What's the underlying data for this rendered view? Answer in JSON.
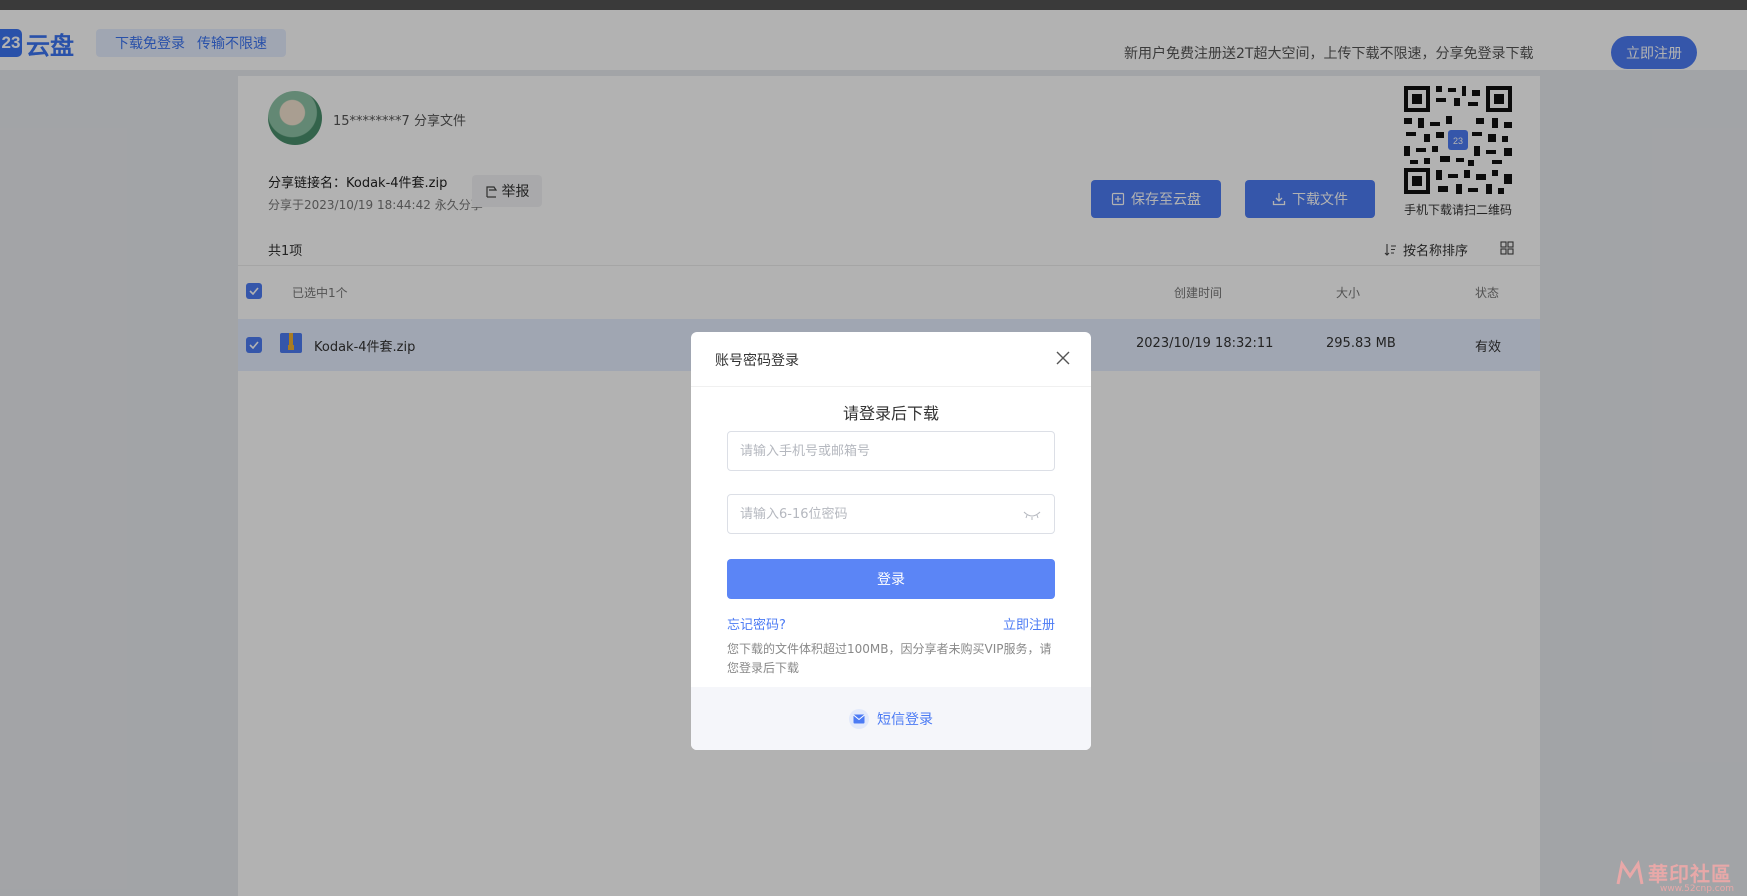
{
  "header": {
    "logo_mark": "23",
    "logo_text": "云盘",
    "promo_1": "下载免登录",
    "promo_2": "传输不限速",
    "note": "新用户免费注册送2T超大空间，上传下载不限速，分享免登录下载",
    "register_label": "立即注册"
  },
  "share": {
    "sharer": "15********7 分享文件",
    "link_name": "分享链接名：Kodak-4件套.zip",
    "date": "分享于2023/10/19 18:44:42 永久分享",
    "report_label": "举报",
    "save_label": "保存至云盘",
    "download_label": "下载文件",
    "qr_caption": "手机下载请扫二维码"
  },
  "list": {
    "count": "共1项",
    "sort_label": "按名称排序",
    "headers": {
      "selected": "已选中1个",
      "created": "创建时间",
      "size": "大小",
      "status": "状态"
    },
    "rows": [
      {
        "name": "Kodak-4件套.zip",
        "created": "2023/10/19 18:32:11",
        "size": "295.83 MB",
        "status": "有效"
      }
    ]
  },
  "modal": {
    "title": "账号密码登录",
    "heading": "请登录后下载",
    "account_placeholder": "请输入手机号或邮箱号",
    "password_placeholder": "请输入6-16位密码",
    "login_label": "登录",
    "forgot_label": "忘记密码?",
    "register_label": "立即注册",
    "notice": "您下载的文件体积超过100MB，因分享者未购买VIP服务，请您登录后下载",
    "sms_label": "短信登录"
  },
  "watermark": {
    "text": "華印社區",
    "sub": "www.52cnp.com"
  },
  "colors": {
    "accent": "#4c7bf4",
    "login_button": "#5b85f6",
    "selected_row": "#e6eeff"
  }
}
